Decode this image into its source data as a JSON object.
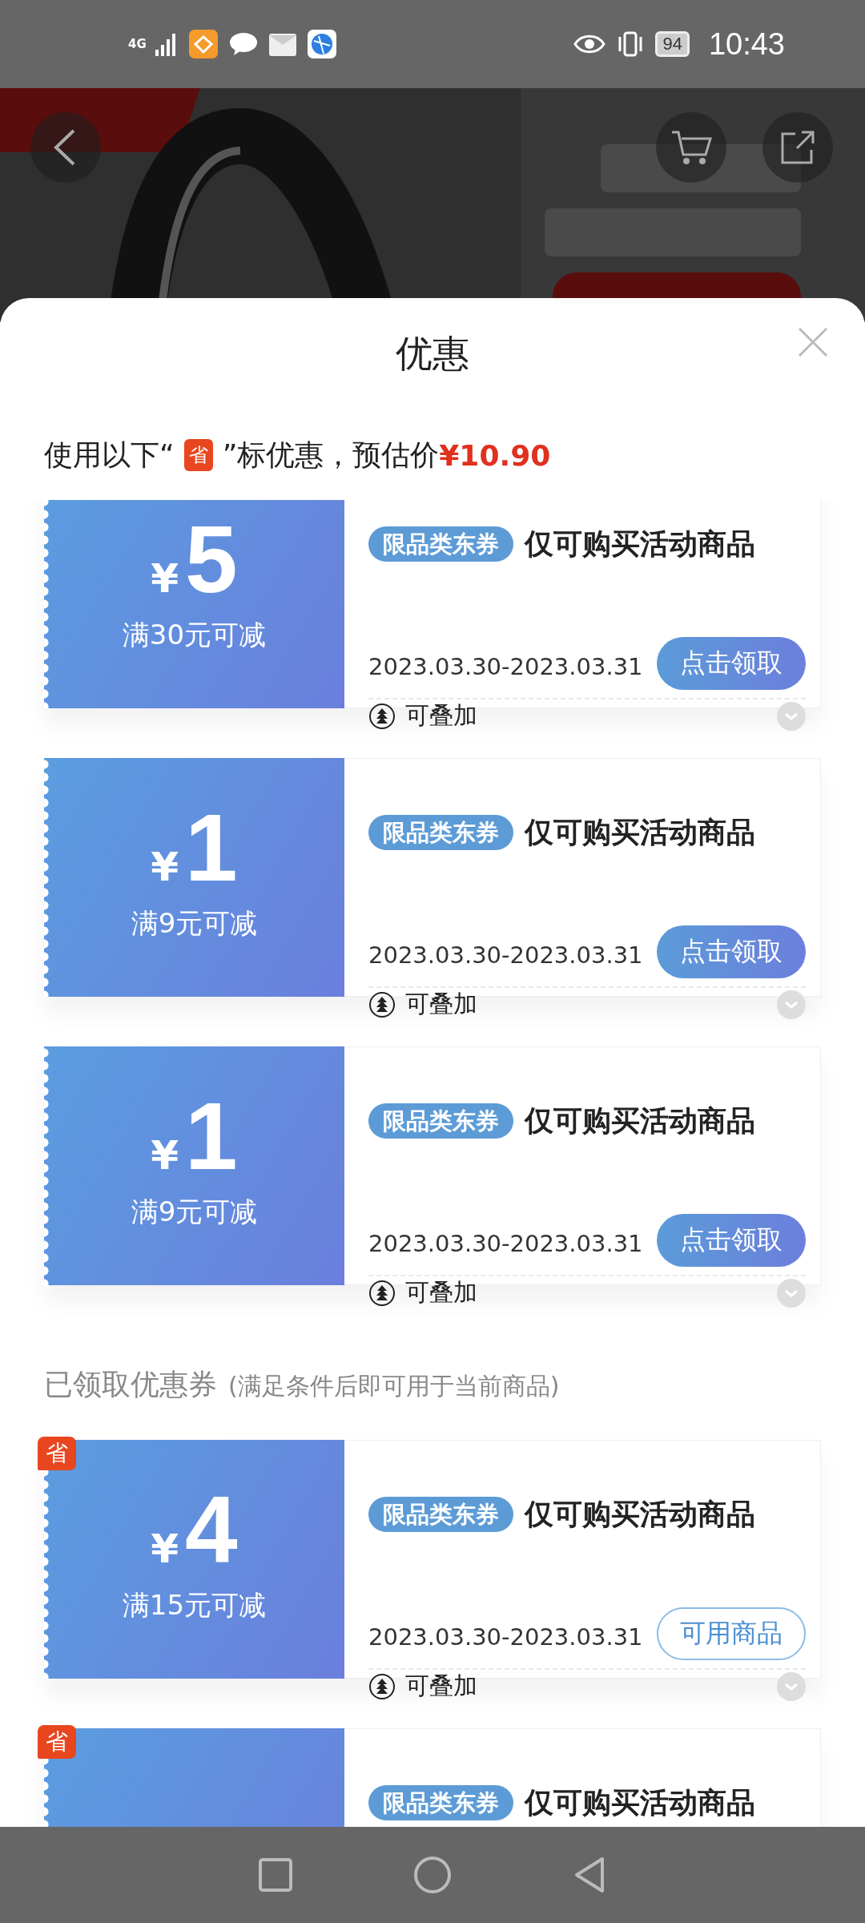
{
  "status_bar": {
    "network": "4G",
    "battery": "94",
    "time": "10:43"
  },
  "sheet": {
    "title": "优惠",
    "hint": {
      "before": "使用以下“",
      "badge": "省",
      "after": "”标优惠，预估价",
      "price": "¥10.90"
    }
  },
  "available_coupons": [
    {
      "currency": "¥",
      "amount": "5",
      "condition": "满30元可减",
      "tag": "限品类东券",
      "title": "仅可购买活动商品",
      "dates": "2023.03.30-2023.03.31",
      "action": {
        "label": "点击领取",
        "kind": "filled"
      },
      "stack": "可叠加"
    },
    {
      "currency": "¥",
      "amount": "1",
      "condition": "满9元可减",
      "tag": "限品类东券",
      "title": "仅可购买活动商品",
      "dates": "2023.03.30-2023.03.31",
      "action": {
        "label": "点击领取",
        "kind": "filled"
      },
      "stack": "可叠加"
    },
    {
      "currency": "¥",
      "amount": "1",
      "condition": "满9元可减",
      "tag": "限品类东券",
      "title": "仅可购买活动商品",
      "dates": "2023.03.30-2023.03.31",
      "action": {
        "label": "点击领取",
        "kind": "filled"
      },
      "stack": "可叠加"
    }
  ],
  "claimed_section": {
    "heading": "已领取优惠券",
    "note": "(满足条件后即可用于当前商品)"
  },
  "claimed_coupons": [
    {
      "badge": "省",
      "currency": "¥",
      "amount": "4",
      "condition": "满15元可减",
      "tag": "限品类东券",
      "title": "仅可购买活动商品",
      "dates": "2023.03.30-2023.03.31",
      "action": {
        "label": "可用商品",
        "kind": "outline"
      },
      "stack": "可叠加"
    },
    {
      "badge": "省",
      "tag": "限品类东券",
      "title": "仅可购买活动商品"
    }
  ]
}
